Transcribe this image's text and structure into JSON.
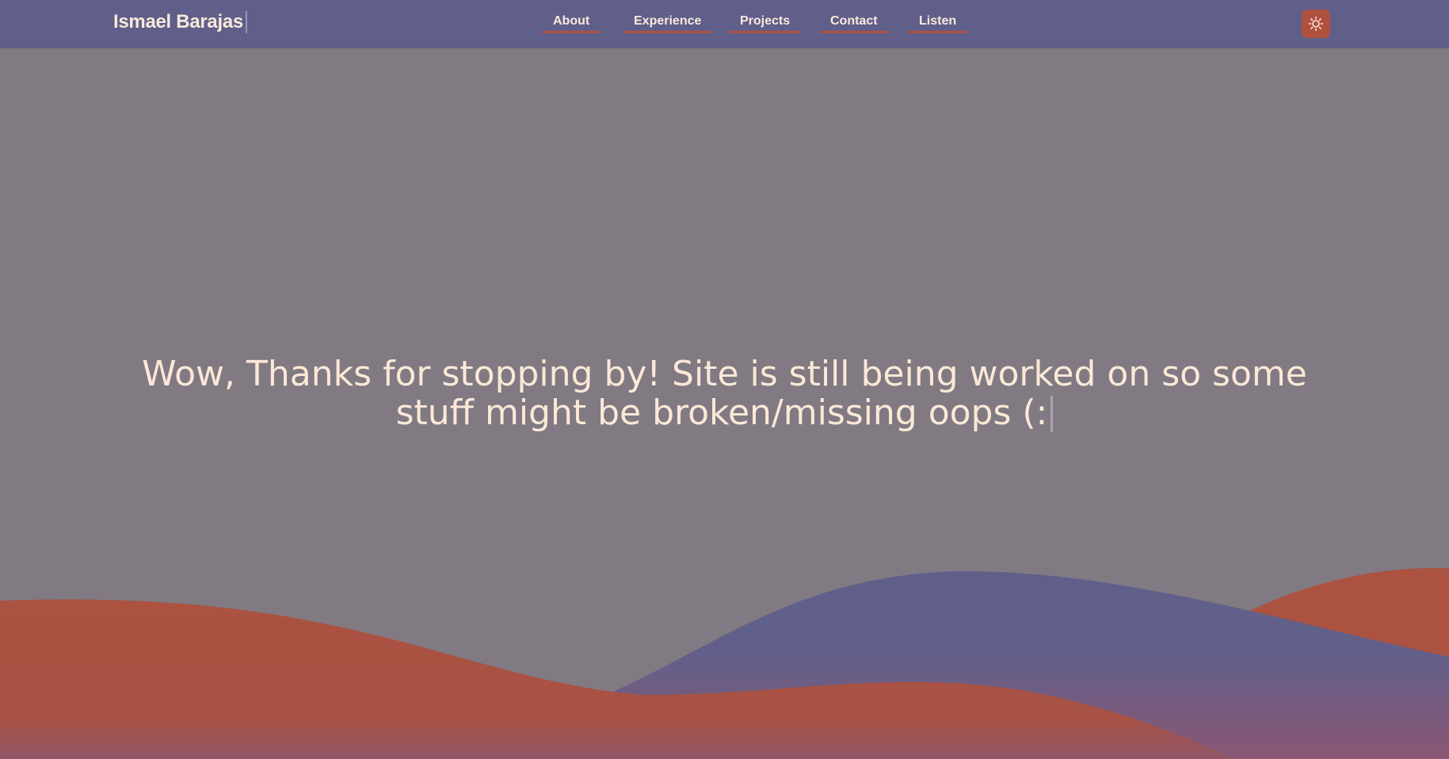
{
  "header": {
    "brand": "Ismael Barajas",
    "nav": [
      {
        "label": "About"
      },
      {
        "label": "Experience"
      },
      {
        "label": "Projects"
      },
      {
        "label": "Contact"
      },
      {
        "label": "Listen"
      }
    ],
    "theme_toggle_icon": "sun-icon"
  },
  "hero": {
    "line1": "Wow, Thanks for stopping by! Site is still being worked on so some",
    "line2": "stuff might be broken/missing oops (:"
  },
  "colors": {
    "navbar": "#5f5f8a",
    "background": "#817a82",
    "accent": "#b0503e",
    "text": "#fbe8dc"
  }
}
